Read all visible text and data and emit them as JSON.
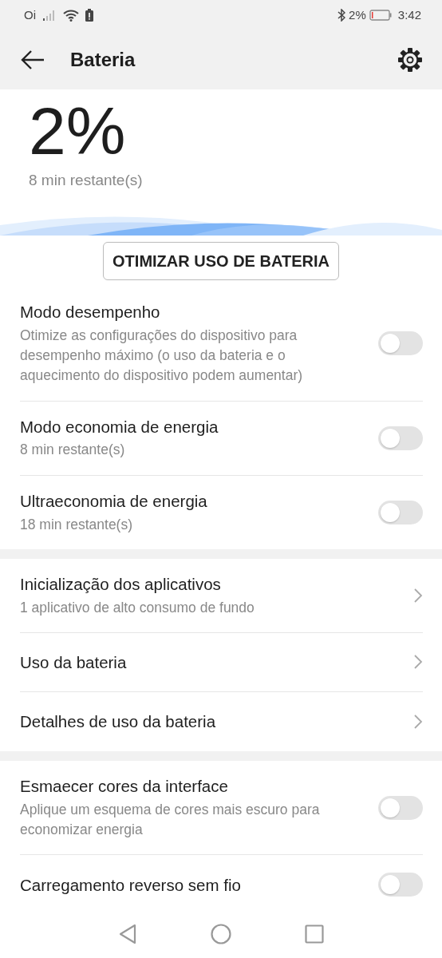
{
  "status_bar": {
    "carrier": "Oi",
    "battery_text": "2%",
    "time": "3:42"
  },
  "header": {
    "title": "Bateria"
  },
  "summary": {
    "percent": "2%",
    "remaining": "8 min restante(s)"
  },
  "optimize_button": "OTIMIZAR USO DE BATERIA",
  "sections": [
    {
      "items": [
        {
          "kind": "toggle",
          "title": "Modo desempenho",
          "subtitle": "Otimize as configurações do dispositivo para desempenho máximo (o uso da bateria e o aquecimento do dispositivo podem aumentar)",
          "on": false
        },
        {
          "kind": "toggle",
          "title": "Modo economia de energia",
          "subtitle": "8 min restante(s)",
          "on": false
        },
        {
          "kind": "toggle",
          "title": "Ultraeconomia de energia",
          "subtitle": "18 min restante(s)",
          "on": false
        }
      ]
    },
    {
      "items": [
        {
          "kind": "link",
          "title": "Inicialização dos aplicativos",
          "subtitle": "1 aplicativo de alto consumo de fundo"
        },
        {
          "kind": "link",
          "title": "Uso da bateria"
        },
        {
          "kind": "link",
          "title": "Detalhes de uso da bateria"
        }
      ]
    },
    {
      "items": [
        {
          "kind": "toggle",
          "title": "Esmaecer cores da interface",
          "subtitle": "Aplique um esquema de cores mais escuro para economizar energia",
          "on": false
        },
        {
          "kind": "toggle",
          "title": "Carregamento reverso sem fio",
          "on": false
        }
      ]
    }
  ]
}
